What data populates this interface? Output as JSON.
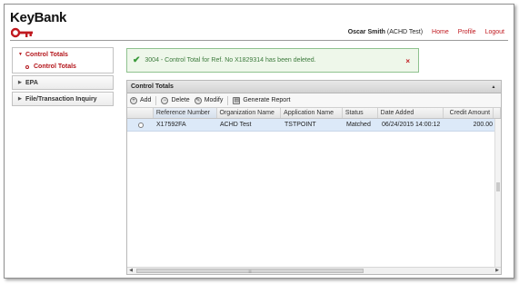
{
  "brand": {
    "name": "KeyBank",
    "logo_color": "#c0191f"
  },
  "header": {
    "user_name": "Oscar Smith",
    "user_suffix": "(ACHD Test)",
    "links": [
      "Home",
      "Profile",
      "Logout"
    ]
  },
  "sidebar": {
    "groups": [
      {
        "label": "Control Totals",
        "expanded": true,
        "icon": "triangle-down-icon",
        "items": [
          "Control Totals"
        ]
      },
      {
        "label": "EPA",
        "expanded": false,
        "icon": "triangle-right-icon",
        "items": []
      },
      {
        "label": "File/Transaction Inquiry",
        "expanded": false,
        "icon": "triangle-right-icon",
        "items": []
      }
    ]
  },
  "alert": {
    "message": "3004 - Control Total for Ref. No X1829314 has been deleted.",
    "icon": "check-icon",
    "close_glyph": "×",
    "color": "#3c7a3c"
  },
  "panel": {
    "title": "Control Totals",
    "toolbar": {
      "add": "Add",
      "delete": "Delete",
      "modify": "Modify",
      "generate_report": "Generate Report"
    },
    "columns": [
      "Reference Number",
      "Organization Name",
      "Application Name",
      "Status",
      "Date Added",
      "Credit Amount"
    ],
    "rows": [
      [
        "X17592FA",
        "ACHD Test",
        "TSTPOINT",
        "Matched",
        "06/24/2015 14:00:12",
        "200.00"
      ]
    ],
    "selected_row_color": "#dce9f8"
  }
}
